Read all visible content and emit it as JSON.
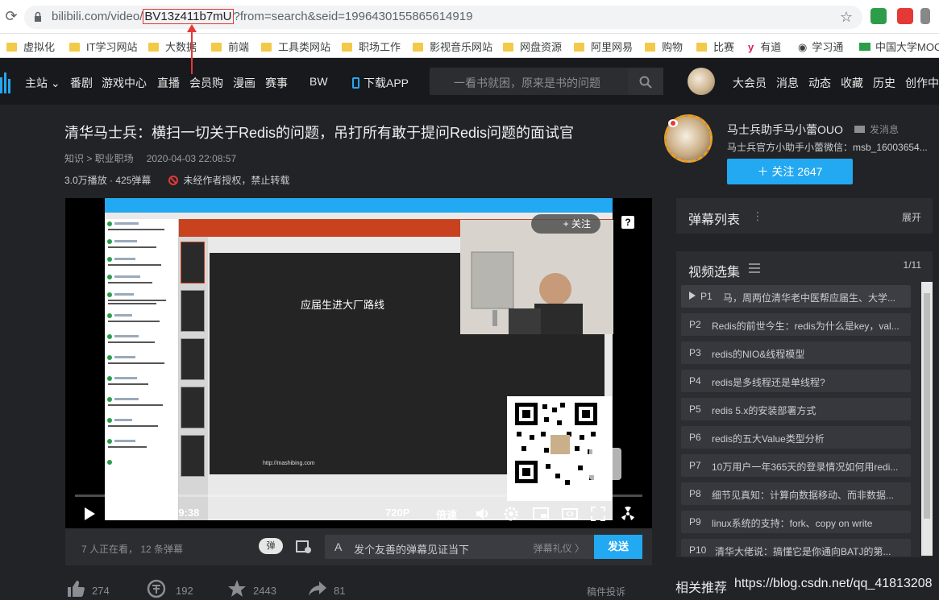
{
  "browser": {
    "url_host": "bilibili.com/video/",
    "url_highlight": "BV13z411b7mU",
    "url_rest": "?from=search&seid=1996430155865614919",
    "bookmarks": [
      "虚拟化",
      "IT学习网站",
      "大数据",
      "前端",
      "工具类网站",
      "职场工作",
      "影视音乐网站",
      "网盘资源",
      "阿里网易",
      "购物",
      "比赛",
      "有道",
      "学习通",
      "中国大学MOOC"
    ]
  },
  "header": {
    "nav": [
      "主站",
      "番剧",
      "游戏中心",
      "直播",
      "会员购",
      "漫画",
      "赛事",
      "BW",
      "下载APP"
    ],
    "search_placeholder": "一看书就困，原来是书的问题",
    "right_nav": [
      "大会员",
      "消息",
      "动态",
      "收藏",
      "历史",
      "创作中心"
    ]
  },
  "video": {
    "title": "清华马士兵：横扫一切关于Redis的问题，吊打所有敢于提问Redis问题的面试官",
    "category": "知识 > 职业职场",
    "date": "2020-04-03 22:08:57",
    "stats": "3.0万播放 · 425弹幕",
    "rights": "未经作者授权，禁止转载",
    "board_text": "应届生进大厂路线",
    "board_url": "http://mashibing.com",
    "follow_overlay": "+ 关注",
    "time_current": "00:00",
    "time_sep": "/",
    "time_total": "59:38",
    "quality": "720P",
    "speed": "倍速"
  },
  "danmaku_bar": {
    "info": "7 人正在看， 12 条弹幕",
    "toggle": "弹",
    "placeholder": "发个友善的弹幕见证当下",
    "etiquette": "弹幕礼仪 〉",
    "send": "发送"
  },
  "actions": [
    {
      "icon": "like-icon",
      "count": "274"
    },
    {
      "icon": "coin-icon",
      "count": "192"
    },
    {
      "icon": "favorite-icon",
      "count": "2443"
    },
    {
      "icon": "share-icon",
      "count": "81"
    }
  ],
  "report": "稿件投诉",
  "uploader": {
    "name": "马士兵助手马小蕾OUO",
    "message": "发消息",
    "desc": "马士兵官方小助手小蕾微信：msb_16003654...",
    "follow": "＋ 关注 2647"
  },
  "danmaku_list": {
    "title": "弹幕列表",
    "expand": "展开"
  },
  "playlist": {
    "title": "视频选集",
    "count": "1/11",
    "items": [
      {
        "num": "P1",
        "text": "马，周两位清华老中医帮应届生、大学..."
      },
      {
        "num": "P2",
        "text": "Redis的前世今生：redis为什么是key，val..."
      },
      {
        "num": "P3",
        "text": "redis的NIO&线程模型"
      },
      {
        "num": "P4",
        "text": "redis是多线程还是单线程?"
      },
      {
        "num": "P5",
        "text": "redis 5.x的安装部署方式"
      },
      {
        "num": "P6",
        "text": "redis的五大Value类型分析"
      },
      {
        "num": "P7",
        "text": "10万用户一年365天的登录情况如何用redi..."
      },
      {
        "num": "P8",
        "text": "细节见真知：计算向数据移动、而非数据..."
      },
      {
        "num": "P9",
        "text": "linux系统的支持：fork、copy on write"
      },
      {
        "num": "P10",
        "text": "清华大佬说：搞懂它是你通向BATJ的第..."
      }
    ]
  },
  "related": "相关推荐",
  "watermark": "https://blog.csdn.net/qq_41813208",
  "colors": {
    "accent": "#23a8f2",
    "bg": "#212326",
    "panel": "#2b2d31",
    "red": "#e53935"
  }
}
